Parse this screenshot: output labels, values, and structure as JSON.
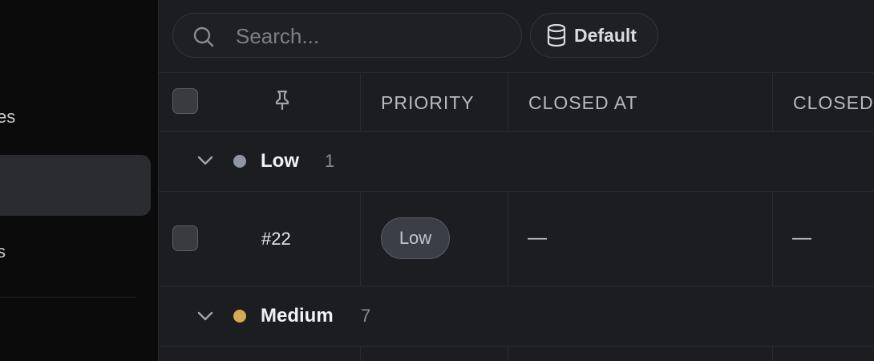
{
  "sidebar": {
    "item_fragment_1": "es",
    "item_fragment_2": "s",
    "item_fragment_3": "‧"
  },
  "toolbar": {
    "search": {
      "placeholder": "Search...",
      "icon": "search-icon"
    },
    "view_button": {
      "label": "Default",
      "icon": "database-icon"
    }
  },
  "table": {
    "columns": [
      {
        "key": "pin",
        "label": "",
        "icon": "pin-icon"
      },
      {
        "key": "priority",
        "label": "PRIORITY"
      },
      {
        "key": "closed_at",
        "label": "CLOSED AT"
      },
      {
        "key": "closed",
        "label": "CLOSED"
      }
    ],
    "groups": [
      {
        "label": "Low",
        "count": "1",
        "color": "#8f95a3",
        "rows": [
          {
            "id": "#22",
            "priority": "Low",
            "closed_at": "—",
            "closed": "—"
          }
        ]
      },
      {
        "label": "Medium",
        "count": "7",
        "color": "#d8a955",
        "rows": []
      }
    ]
  },
  "colors": {
    "background": "#1c1d20",
    "sidebar": "#0b0b0c",
    "border": "#2a2b30"
  }
}
